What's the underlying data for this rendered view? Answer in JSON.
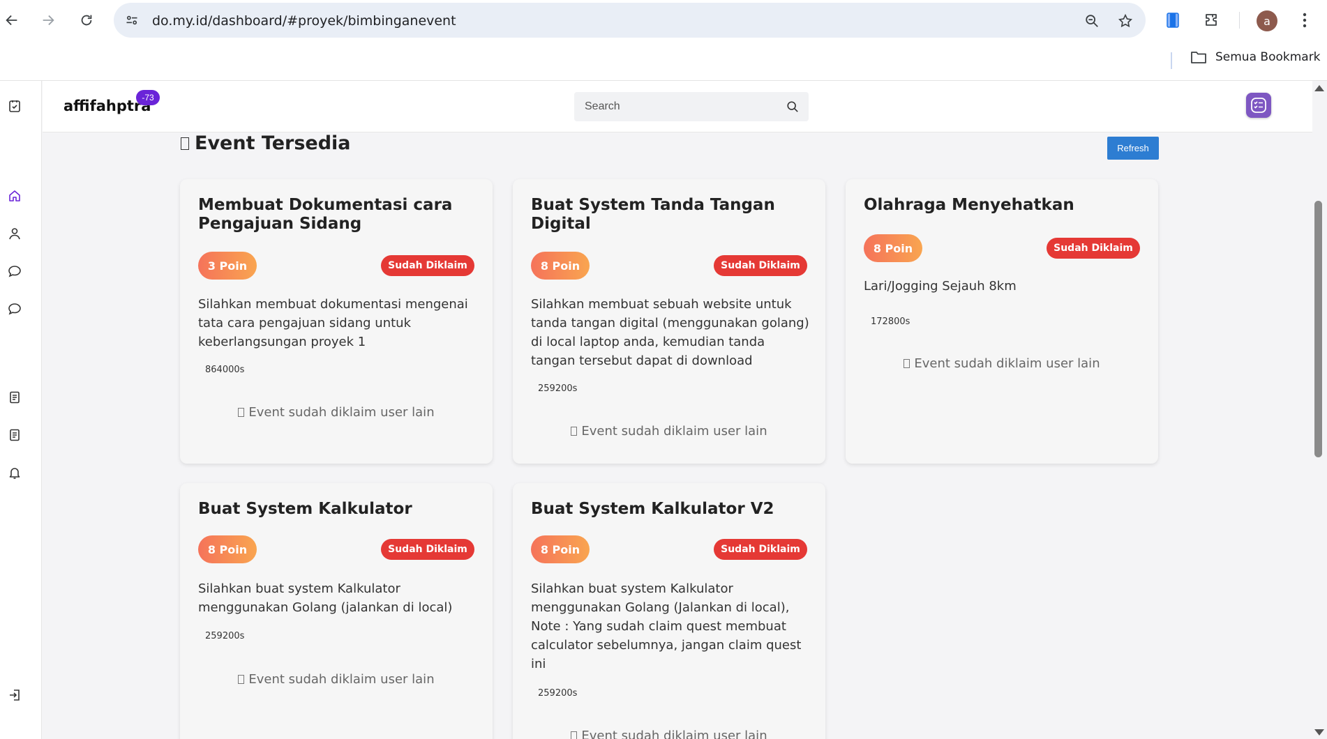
{
  "browser": {
    "url": "do.my.id/dashboard/#proyek/bimbinganevent",
    "profile_initial": "a",
    "bookmark_all_label": "Semua Bookmark"
  },
  "app": {
    "username": "affifahptra",
    "badge": "-73",
    "search_placeholder": "Search",
    "accent_color": "#6a24d8"
  },
  "section": {
    "title": "Event Tersedia",
    "refresh_label": "Refresh"
  },
  "events": [
    {
      "title": "Membuat Dokumentasi cara Pengajuan Sidang",
      "points": "3 Poin",
      "status": "Sudah Diklaim",
      "description": "Silahkan membuat dokumentasi mengenai tata cara pengajuan sidang untuk keberlangsungan proyek 1",
      "duration": "864000s",
      "note": "Event sudah diklaim user lain"
    },
    {
      "title": "Buat System Tanda Tangan Digital",
      "points": "8 Poin",
      "status": "Sudah Diklaim",
      "description": "Silahkan membuat sebuah website untuk tanda tangan digital (menggunakan golang) di local laptop anda, kemudian tanda tangan tersebut dapat di download",
      "duration": "259200s",
      "note": "Event sudah diklaim user lain"
    },
    {
      "title": "Olahraga Menyehatkan",
      "points": "8 Poin",
      "status": "Sudah Diklaim",
      "description": "Lari/Jogging Sejauh 8km",
      "duration": "172800s",
      "note": "Event sudah diklaim user lain"
    },
    {
      "title": "Buat System Kalkulator",
      "points": "8 Poin",
      "status": "Sudah Diklaim",
      "description": "Silahkan buat system Kalkulator menggunakan Golang (jalankan di local)",
      "duration": "259200s",
      "note": "Event sudah diklaim user lain"
    },
    {
      "title": "Buat System Kalkulator V2",
      "points": "8 Poin",
      "status": "Sudah Diklaim",
      "description": "Silahkan buat system Kalkulator menggunakan Golang (Jalankan di local), Note : Yang sudah claim quest membuat calculator sebelumnya, jangan claim quest ini",
      "duration": "259200s",
      "note": "Event sudah diklaim user lain"
    }
  ]
}
